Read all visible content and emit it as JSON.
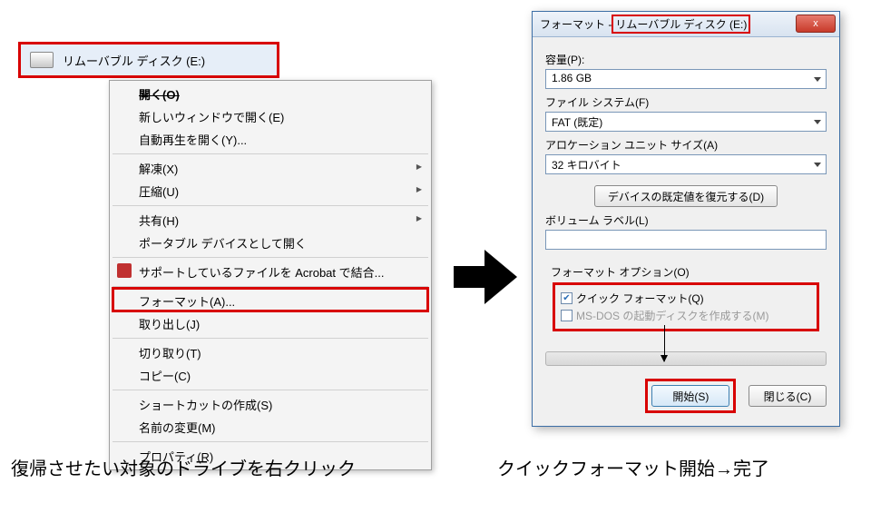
{
  "drive": {
    "label": "リムーバブル ディスク (E:)"
  },
  "menu": {
    "open": "開く(O)",
    "open_new_window": "新しいウィンドウで開く(E)",
    "autoplay": "自動再生を開く(Y)...",
    "unfreeze": "解凍(X)",
    "compress": "圧縮(U)",
    "share": "共有(H)",
    "open_as_portable": "ポータブル デバイスとして開く",
    "acrobat_combine": "サポートしているファイルを Acrobat で結合...",
    "format": "フォーマット(A)...",
    "eject": "取り出し(J)",
    "cut": "切り取り(T)",
    "copy": "コピー(C)",
    "create_shortcut": "ショートカットの作成(S)",
    "rename": "名前の変更(M)",
    "properties": "プロパティ(R)"
  },
  "dialog": {
    "title_prefix": "フォーマット - ",
    "title_drive": "リムーバブル ディスク (E:)",
    "capacity_label": "容量(P):",
    "capacity_value": "1.86 GB",
    "filesystem_label": "ファイル システム(F)",
    "filesystem_value": "FAT (既定)",
    "alloc_label": "アロケーション ユニット サイズ(A)",
    "alloc_value": "32 キロバイト",
    "restore_defaults": "デバイスの既定値を復元する(D)",
    "volume_label": "ボリューム ラベル(L)",
    "options_label": "フォーマット オプション(O)",
    "quick_format": "クイック フォーマット(Q)",
    "msdos_boot": "MS-DOS の起動ディスクを作成する(M)",
    "start": "開始(S)",
    "close": "閉じる(C)",
    "x": "x"
  },
  "captions": {
    "left": "復帰させたい対象のドライブを右クリック",
    "right": "クイックフォーマット開始→完了"
  }
}
